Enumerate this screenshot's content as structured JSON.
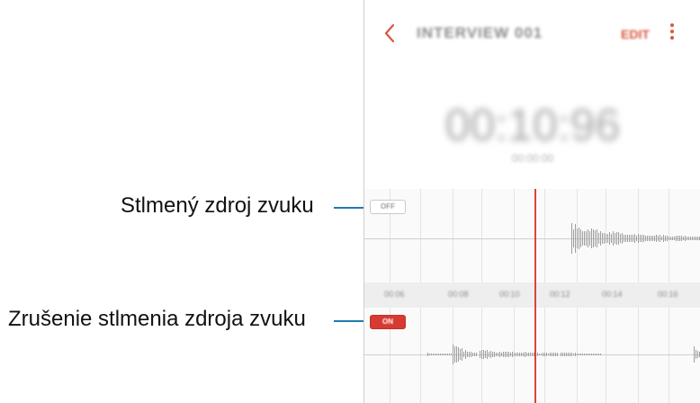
{
  "callouts": {
    "muted_source": "Stlmený zdroj zvuku",
    "unmute_source": "Zrušenie stlmenia zdroja zvuku"
  },
  "colors": {
    "accent": "#d9573e",
    "callout_line": "#1f7bb0",
    "playhead": "#d9453a"
  },
  "header": {
    "back_icon": "chevron-left-icon",
    "title": "INTERVIEW 001",
    "edit_label": "EDIT",
    "more_icon": "more-vertical-icon"
  },
  "recorder": {
    "elapsed": "00:10:96",
    "elapsed_sub": "00:00:00"
  },
  "tracks": [
    {
      "toggle_label": "OFF",
      "state": "muted"
    },
    {
      "toggle_label": "ON",
      "state": "unmuted"
    }
  ],
  "timeline": {
    "ticks": [
      "00:06",
      "00:08",
      "00:10",
      "00:12",
      "00:14",
      "00:16"
    ]
  }
}
